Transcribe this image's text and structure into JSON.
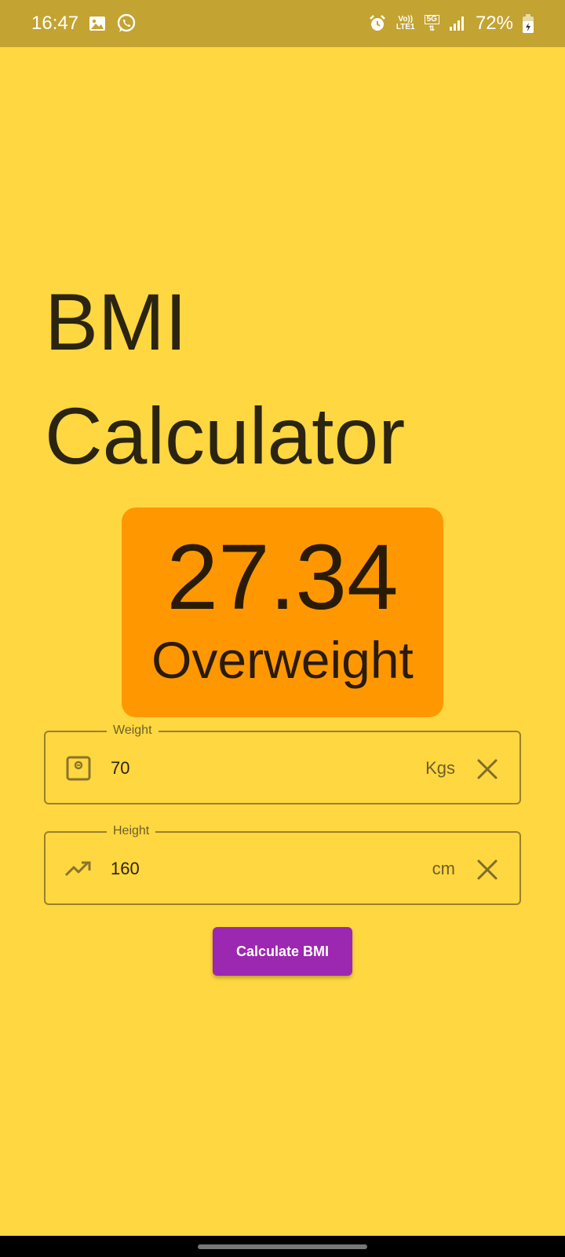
{
  "status_bar": {
    "time": "16:47",
    "network_volte": "Vo))",
    "network_lte": "LTE1",
    "network_5g": "5G",
    "battery": "72%",
    "icons": [
      "gallery-icon",
      "whatsapp-icon",
      "alarm-icon",
      "volte-icon",
      "5g-icon",
      "signal-icon",
      "battery-icon"
    ]
  },
  "title": {
    "line1": "BMI",
    "line2": "Calculator"
  },
  "result": {
    "value": "27.34",
    "category": "Overweight",
    "color": "#FF9800"
  },
  "weight_field": {
    "label": "Weight",
    "value": "70",
    "unit": "Kgs",
    "icon": "scale-icon"
  },
  "height_field": {
    "label": "Height",
    "value": "160",
    "unit": "cm",
    "icon": "trending-up-icon"
  },
  "calculate_button": {
    "label": "Calculate BMI",
    "color": "#9C27B0"
  },
  "theme": {
    "background": "#FFD740",
    "status_bar": "#C3A332"
  }
}
